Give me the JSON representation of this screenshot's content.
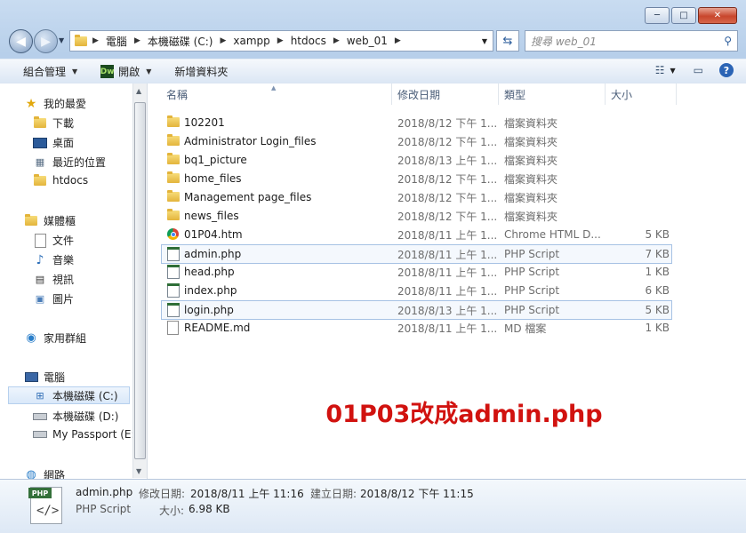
{
  "window": {
    "buttons": {
      "minimize": "─",
      "maximize": "□",
      "close": "✕"
    }
  },
  "address": {
    "crumbs": [
      "電腦",
      "本機磁碟 (C:)",
      "xampp",
      "htdocs",
      "web_01"
    ],
    "search_placeholder": "搜尋 web_01"
  },
  "toolbar": {
    "organize": "組合管理",
    "open": "開啟",
    "dw_badge": "Dw",
    "new_folder": "新增資料夾"
  },
  "nav": {
    "favorites": "我的最愛",
    "downloads": "下載",
    "desktop": "桌面",
    "recent": "最近的位置",
    "htdocs": "htdocs",
    "libraries": "媒體櫃",
    "documents": "文件",
    "music": "音樂",
    "videos": "視訊",
    "pictures": "圖片",
    "homegroup": "家用群組",
    "computer": "電腦",
    "drive_c": "本機磁碟 (C:)",
    "drive_d": "本機磁碟 (D:)",
    "passport": "My Passport (E:)",
    "network": "網路"
  },
  "columns": {
    "name": "名稱",
    "date": "修改日期",
    "type": "類型",
    "size": "大小"
  },
  "files": [
    {
      "name": "102201",
      "date": "2018/8/12 下午 1...",
      "type": "檔案資料夾",
      "size": "",
      "icon": "folder"
    },
    {
      "name": "Administrator Login_files",
      "date": "2018/8/12 下午 1...",
      "type": "檔案資料夾",
      "size": "",
      "icon": "folder"
    },
    {
      "name": "bq1_picture",
      "date": "2018/8/13 上午 1...",
      "type": "檔案資料夾",
      "size": "",
      "icon": "folder"
    },
    {
      "name": "home_files",
      "date": "2018/8/12 下午 1...",
      "type": "檔案資料夾",
      "size": "",
      "icon": "folder"
    },
    {
      "name": "Management page_files",
      "date": "2018/8/12 下午 1...",
      "type": "檔案資料夾",
      "size": "",
      "icon": "folder"
    },
    {
      "name": "news_files",
      "date": "2018/8/12 下午 1...",
      "type": "檔案資料夾",
      "size": "",
      "icon": "folder"
    },
    {
      "name": "01P04.htm",
      "date": "2018/8/11 上午 1...",
      "type": "Chrome HTML D...",
      "size": "5 KB",
      "icon": "chrome"
    },
    {
      "name": "admin.php",
      "date": "2018/8/11 上午 1...",
      "type": "PHP Script",
      "size": "7 KB",
      "icon": "php"
    },
    {
      "name": "head.php",
      "date": "2018/8/11 上午 1...",
      "type": "PHP Script",
      "size": "1 KB",
      "icon": "php"
    },
    {
      "name": "index.php",
      "date": "2018/8/11 上午 1...",
      "type": "PHP Script",
      "size": "6 KB",
      "icon": "php"
    },
    {
      "name": "login.php",
      "date": "2018/8/13 上午 1...",
      "type": "PHP Script",
      "size": "5 KB",
      "icon": "php"
    },
    {
      "name": "README.md",
      "date": "2018/8/11 上午 1...",
      "type": "MD 檔案",
      "size": "1 KB",
      "icon": "doc"
    }
  ],
  "annotation": "01P03改成admin.php",
  "details": {
    "badge": "PHP",
    "name": "admin.php",
    "modified_label": "修改日期:",
    "modified_value": "2018/8/11 上午 11:16",
    "created_label": "建立日期:",
    "created_value": "2018/8/12 下午 11:15",
    "type": "PHP Script",
    "size_label": "大小:",
    "size_value": "6.98 KB"
  }
}
